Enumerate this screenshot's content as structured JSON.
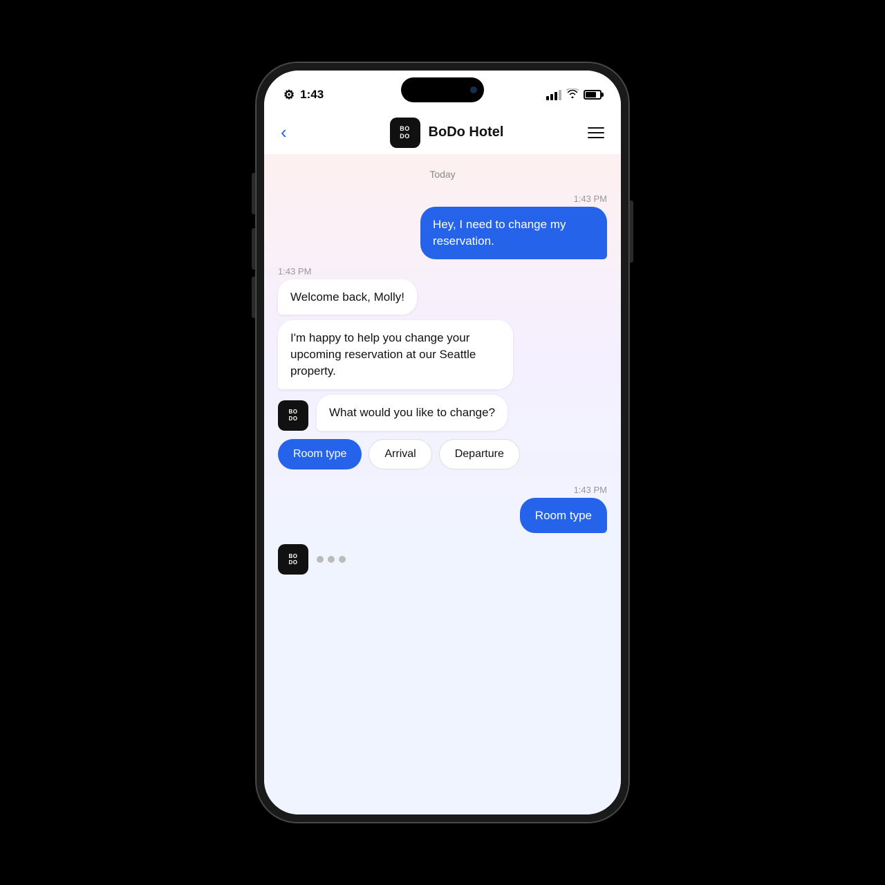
{
  "statusBar": {
    "time": "1:43",
    "timeAriaLabel": "1:43"
  },
  "header": {
    "backLabel": "<",
    "brandName": "BoDo Hotel",
    "brandLogoLine1": "BO",
    "brandLogoLine2": "DO",
    "menuAriaLabel": "Menu"
  },
  "chat": {
    "dateLabel": "Today",
    "messages": [
      {
        "id": "m1",
        "type": "time-right",
        "text": "1:43 PM"
      },
      {
        "id": "m2",
        "type": "user",
        "text": "Hey, I need to change my reservation."
      },
      {
        "id": "m3",
        "type": "time-left",
        "text": "1:43 PM"
      },
      {
        "id": "m4",
        "type": "bot",
        "text": "Welcome back, Molly!"
      },
      {
        "id": "m5",
        "type": "bot",
        "text": "I'm happy to help you change your upcoming reservation at our Seattle property."
      },
      {
        "id": "m6",
        "type": "bot-avatar",
        "text": "What would you like to change?"
      }
    ],
    "quickReplies": [
      {
        "label": "Room type",
        "active": true
      },
      {
        "label": "Arrival",
        "active": false
      },
      {
        "label": "Departure",
        "active": false
      }
    ],
    "userReply": {
      "timeLabel": "1:43 PM",
      "text": "Room type"
    },
    "botAvatar": {
      "line1": "BO",
      "line2": "DO"
    },
    "typingDots": 3
  }
}
